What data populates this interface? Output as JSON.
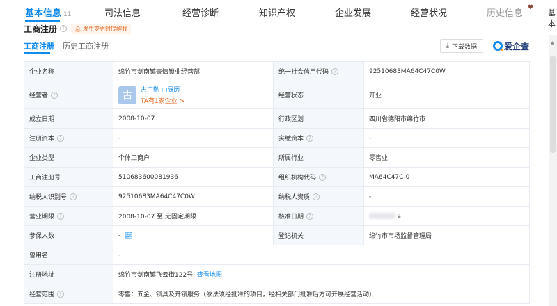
{
  "nav": {
    "tabs": [
      {
        "label": "基本信息",
        "count": "11"
      },
      {
        "label": "司法信息"
      },
      {
        "label": "经营诊断"
      },
      {
        "label": "知识产权"
      },
      {
        "label": "企业发展"
      },
      {
        "label": "经营状况"
      },
      {
        "label": "历史信息"
      }
    ],
    "edge_text": "基本"
  },
  "section": {
    "title": "工商注册",
    "alert": "发生变更时提醒我"
  },
  "subtabs": [
    "工商注册",
    "历史工商注册"
  ],
  "toolbar": {
    "download_label": "下载数据",
    "logo_text": "爱企查"
  },
  "table": {
    "rows": [
      {
        "l1": "企业名称",
        "v1": "绵竹市剑南镇豪情锁业经营部",
        "l2": "统一社会信用代码",
        "v2": "92510683MA64C47C0W"
      },
      {
        "l1": "经营者",
        "l2": "经营状态",
        "v2": "开业"
      },
      {
        "l1": "成立日期",
        "v1": "2008-10-07",
        "l2": "行政区划",
        "v2": "四川省德阳市绵竹市"
      },
      {
        "l1": "注册资本",
        "v1": "-",
        "l2": "实缴资本",
        "v2": "-"
      },
      {
        "l1": "企业类型",
        "v1": "个体工商户",
        "l2": "所属行业",
        "v2": "零售业"
      },
      {
        "l1": "工商注册号",
        "v1": "510683600081936",
        "l2": "组织机构代码",
        "v2": "MA64C47C-0"
      },
      {
        "l1": "纳税人识别号",
        "v1": "92510683MA64C47C0W",
        "l2": "纳税人资质",
        "v2": "-"
      },
      {
        "l1": "营业期限",
        "v1": "2008-10-07 至 无固定期限",
        "l2": "核准日期"
      },
      {
        "l1": "参保人数",
        "v1": "-",
        "l2": "登记机关",
        "v2": "绵竹市市场监督管理局"
      }
    ],
    "operator": {
      "avatar_char": "古",
      "name": "古广勤",
      "resume": "履历",
      "companies": "TA有1家企业 >"
    },
    "former_name": {
      "label": "曾用名",
      "value": "-"
    },
    "address": {
      "label": "注册地址",
      "value": "绵竹市剑南镇飞云街122号",
      "map_link": "查看地图"
    },
    "scope": {
      "label": "经营范围",
      "value": "零售：五金、锁具及开锁服务（依法须经批准的项目，经相关部门批准后方可开展经营活动）"
    }
  },
  "colors": {
    "accent": "#128bed",
    "orange": "#e96a25"
  }
}
